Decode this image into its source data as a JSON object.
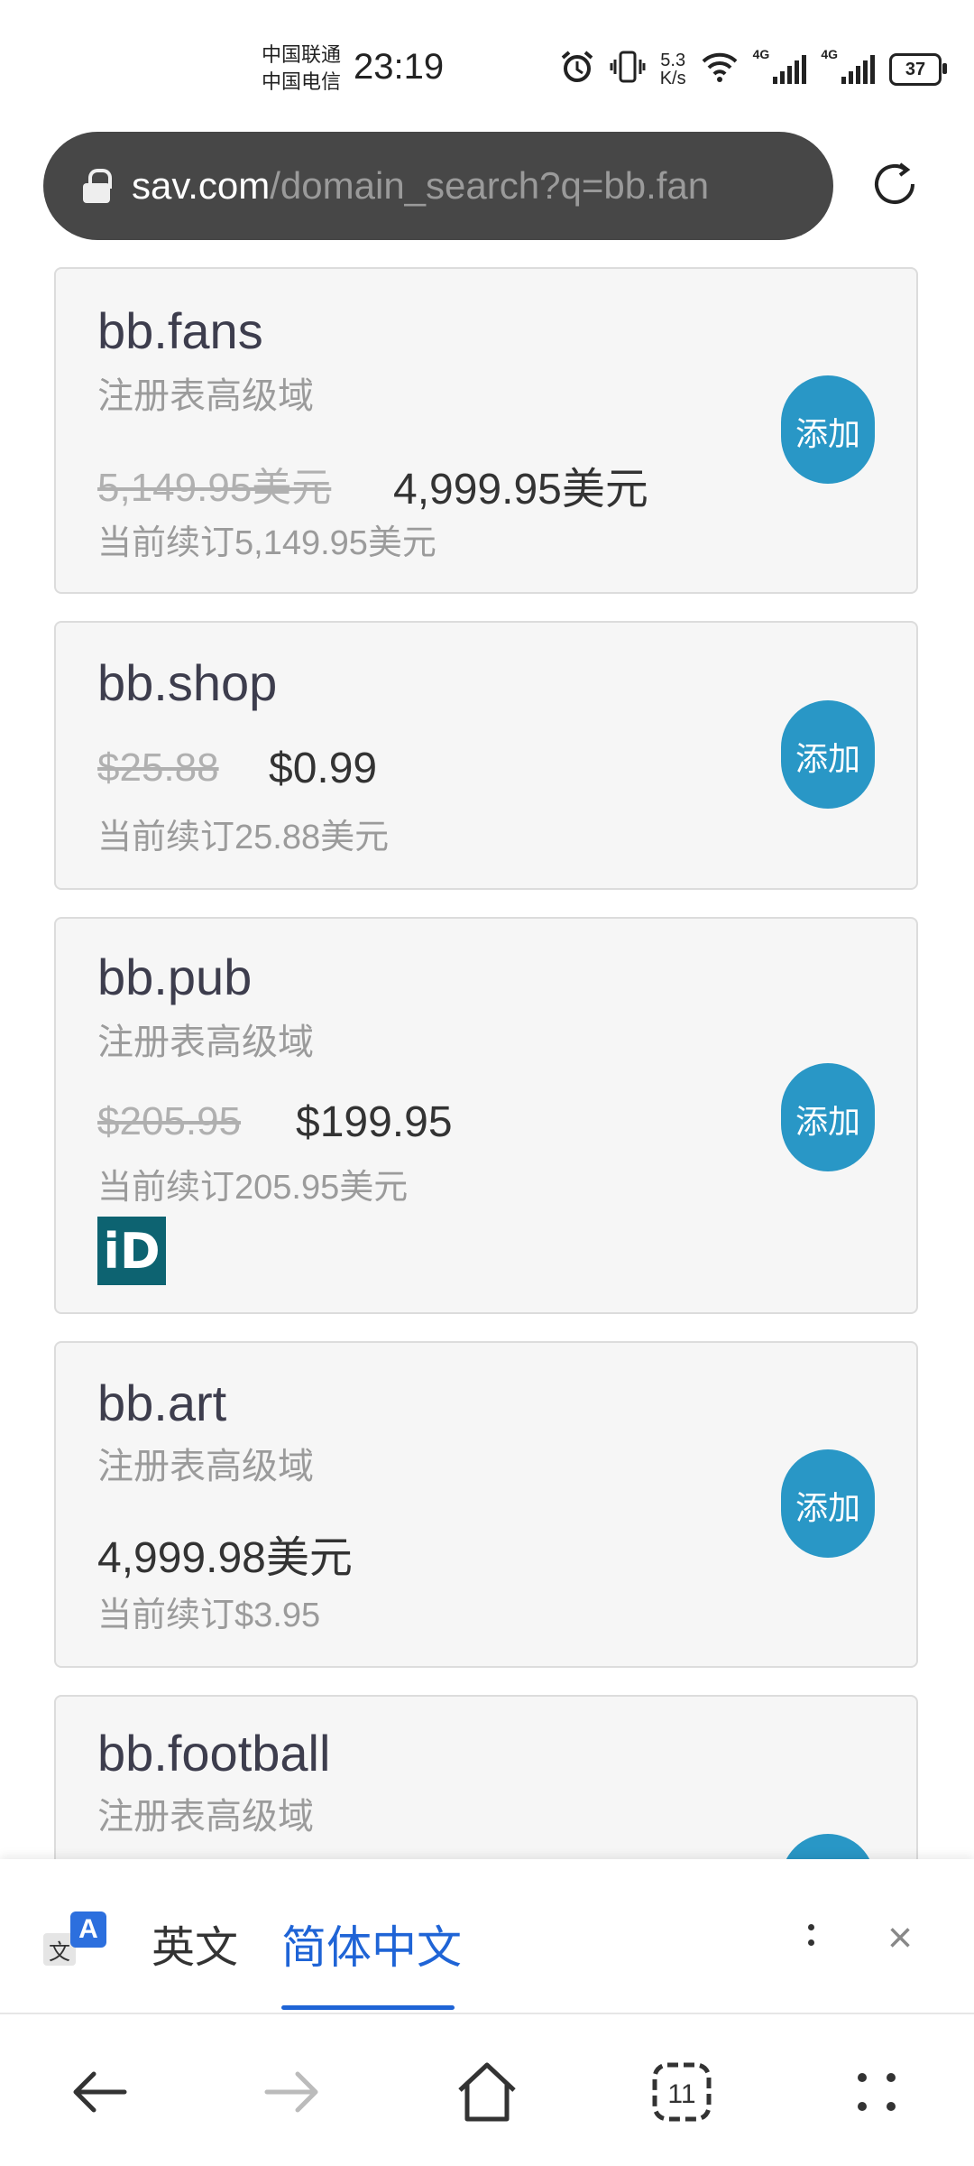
{
  "status": {
    "carrier1": "中国联通",
    "carrier2": "中国电信",
    "time": "23:19",
    "speed_value": "5.3",
    "speed_unit": "K/s",
    "net1": "4G",
    "net2": "4G",
    "battery": "37"
  },
  "urlbar": {
    "host": "sav.com",
    "path": "/domain_search?q=bb.fan"
  },
  "domains": [
    {
      "name": "bb.fans",
      "subtitle": "注册表高级域",
      "old_price": "5,149.95美元",
      "price": "4,999.95美元",
      "renewal": "当前续订5,149.95美元",
      "button": "添加"
    },
    {
      "name": "bb.shop",
      "old_price": "$25.88",
      "price": "$0.99",
      "renewal": "当前续订25.88美元",
      "button": "添加"
    },
    {
      "name": "bb.pub",
      "subtitle": "注册表高级域",
      "old_price": "$205.95",
      "price": "$199.95",
      "renewal": "当前续订205.95美元",
      "button": "添加",
      "logo": "iD"
    },
    {
      "name": "bb.art",
      "subtitle": "注册表高级域",
      "price": "4,999.98美元",
      "renewal": "当前续订$3.95",
      "button": "添加"
    },
    {
      "name": "bb.football",
      "subtitle": "注册表高级域",
      "button": "添加"
    }
  ],
  "translate": {
    "icon_letter": "A",
    "icon_word": "文",
    "lang_source": "英文",
    "lang_target": "简体中文",
    "close": "×"
  },
  "nav": {
    "tabs_count": "11"
  },
  "colors": {
    "accent": "#2997c6",
    "translate_active": "#1f64d6",
    "urlbar_bg": "#474747"
  }
}
